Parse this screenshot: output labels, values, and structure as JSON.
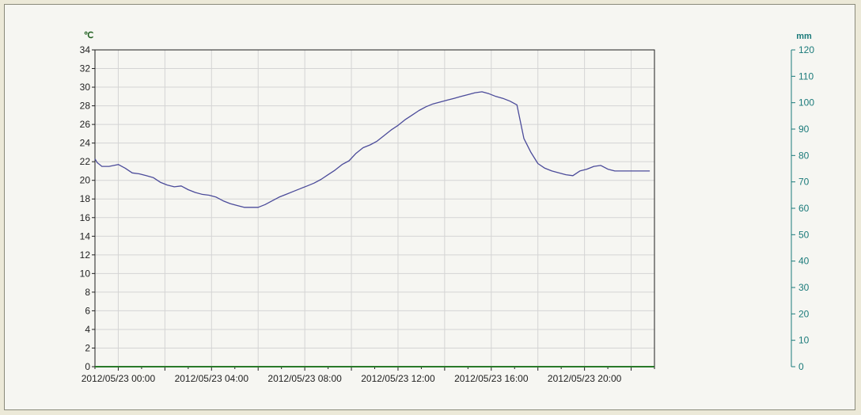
{
  "chart_data": {
    "type": "line",
    "title": "",
    "left_axis": {
      "unit": "℃",
      "ylim": [
        0,
        34
      ],
      "ticks": [
        0,
        2,
        4,
        6,
        8,
        10,
        12,
        14,
        16,
        18,
        20,
        22,
        24,
        26,
        28,
        30,
        32,
        34
      ]
    },
    "right_axis": {
      "unit": "mm",
      "ylim": [
        0,
        120
      ],
      "ticks": [
        0,
        10,
        20,
        30,
        40,
        50,
        60,
        70,
        80,
        90,
        100,
        110,
        120
      ],
      "color": "#1a7a7a"
    },
    "x_axis": {
      "range_hours": [
        -1,
        23
      ],
      "tick_labels": [
        "2012/05/23 00:00",
        "2012/05/23 04:00",
        "2012/05/23 08:00",
        "2012/05/23 12:00",
        "2012/05/23 16:00",
        "2012/05/23 20:00"
      ]
    },
    "grid": true,
    "colors": {
      "series": "#4b4b9a",
      "left_axis": "#1f5f1f",
      "x_axis": "#2a7a2a",
      "grid": "#d4d4d4"
    },
    "series": [
      {
        "values_x_hours": [
          -1.2,
          -0.9,
          -0.7,
          -0.4,
          0.0,
          0.3,
          0.6,
          0.9,
          1.2,
          1.5,
          1.8,
          2.1,
          2.4,
          2.7,
          3.0,
          3.3,
          3.6,
          3.9,
          4.2,
          4.5,
          4.8,
          5.1,
          5.4,
          5.7,
          6.0,
          6.3,
          6.6,
          6.9,
          7.2,
          7.5,
          7.8,
          8.1,
          8.4,
          8.7,
          9.0,
          9.3,
          9.6,
          9.9,
          10.2,
          10.5,
          10.8,
          11.1,
          11.4,
          11.7,
          12.0,
          12.3,
          12.6,
          12.9,
          13.2,
          13.5,
          13.8,
          14.1,
          14.4,
          14.7,
          15.0,
          15.3,
          15.6,
          15.9,
          16.2,
          16.5,
          16.8,
          17.1,
          17.4,
          17.7,
          18.0,
          18.3,
          18.6,
          18.9,
          19.2,
          19.5,
          19.8,
          20.1,
          20.4,
          20.7,
          21.0,
          21.3,
          21.6,
          21.9,
          22.2,
          22.5,
          22.8
        ],
        "values_y": [
          22.3,
          21.9,
          21.5,
          21.5,
          21.7,
          21.3,
          20.8,
          20.7,
          20.5,
          20.3,
          19.8,
          19.5,
          19.3,
          19.4,
          19.0,
          18.7,
          18.5,
          18.4,
          18.2,
          17.8,
          17.5,
          17.3,
          17.1,
          17.1,
          17.1,
          17.4,
          17.8,
          18.2,
          18.5,
          18.8,
          19.1,
          19.4,
          19.7,
          20.1,
          20.6,
          21.1,
          21.7,
          22.1,
          22.9,
          23.5,
          23.8,
          24.2,
          24.8,
          25.4,
          25.9,
          26.5,
          27.0,
          27.5,
          27.9,
          28.2,
          28.4,
          28.6,
          28.8,
          29.0,
          29.2,
          29.4,
          29.5,
          29.3,
          29.0,
          28.8,
          28.5,
          28.1,
          24.5,
          23.0,
          21.8,
          21.3,
          21.0,
          20.8,
          20.6,
          20.5,
          21.0,
          21.2,
          21.5,
          21.6,
          21.2,
          21.0,
          21.0,
          21.0,
          21.0,
          21.0,
          21.0
        ]
      }
    ]
  }
}
